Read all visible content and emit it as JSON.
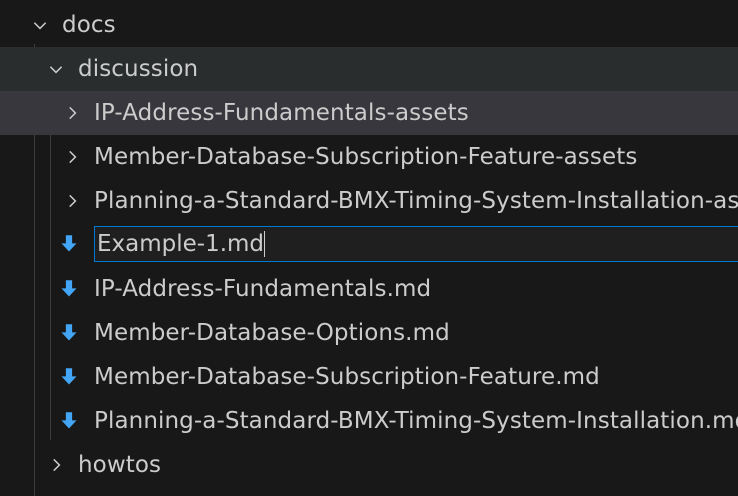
{
  "explorer": {
    "folder_docs": {
      "label": "docs",
      "expanded": true
    },
    "folder_discussion": {
      "label": "discussion",
      "expanded": true
    },
    "folders": [
      {
        "label": "IP-Address-Fundamentals-assets",
        "expanded": false
      },
      {
        "label": "Member-Database-Subscription-Feature-assets",
        "expanded": false
      },
      {
        "label": "Planning-a-Standard-BMX-Timing-System-Installation-assets",
        "expanded": false
      }
    ],
    "rename": {
      "value": "Example-1.md"
    },
    "files": [
      {
        "label": "IP-Address-Fundamentals.md"
      },
      {
        "label": "Member-Database-Options.md"
      },
      {
        "label": "Member-Database-Subscription-Feature.md"
      },
      {
        "label": "Planning-a-Standard-BMX-Timing-System-Installation.md"
      }
    ],
    "folder_howtos": {
      "label": "howtos",
      "expanded": false
    }
  },
  "colors": {
    "background": "#181818",
    "hover_row": "#2a2d2e",
    "selected_row": "#37373d",
    "focus_border": "#0078d4",
    "markdown_icon": "#42a5f5",
    "text": "#cccccc"
  }
}
